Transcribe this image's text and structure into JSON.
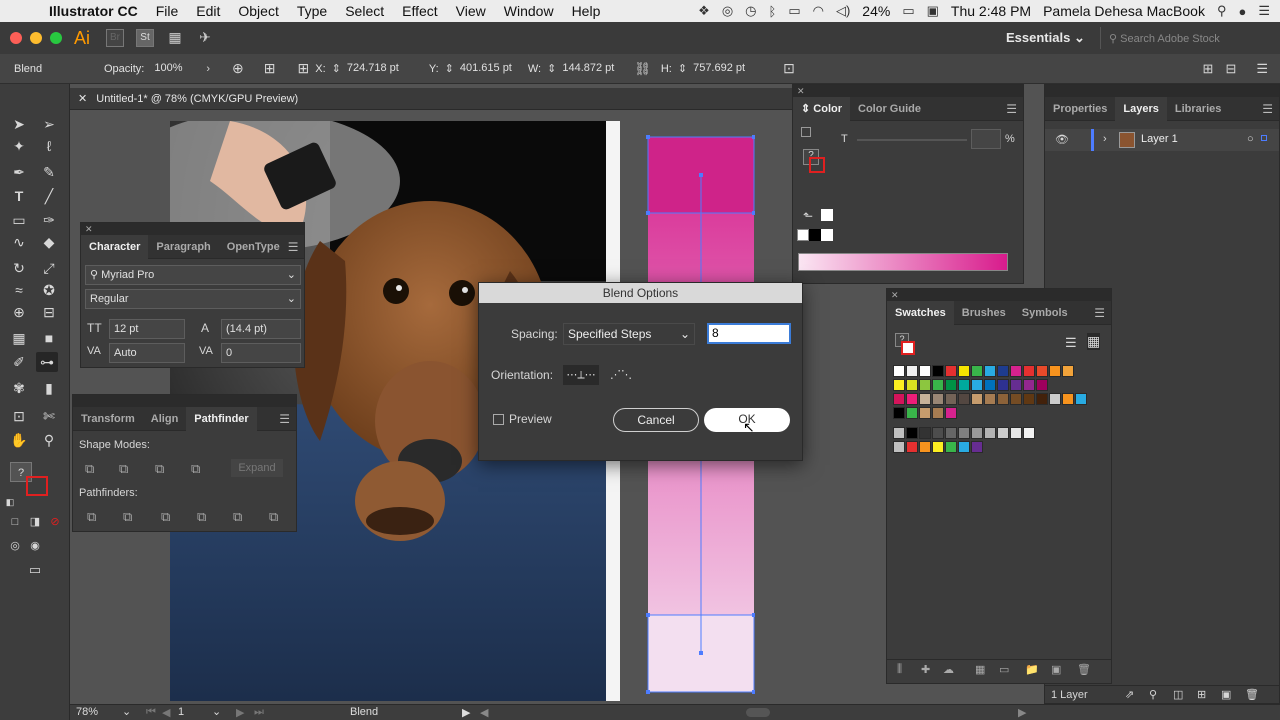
{
  "menubar": {
    "app_name": "Illustrator CC",
    "menus": [
      "File",
      "Edit",
      "Object",
      "Type",
      "Select",
      "Effect",
      "View",
      "Window",
      "Help"
    ],
    "battery": "24%",
    "clock": "Thu 2:48 PM",
    "user": "Pamela Dehesa MacBook"
  },
  "appbar": {
    "logo": "Ai",
    "br_label": "Br",
    "st_label": "St",
    "workspace": "Essentials",
    "search_placeholder": "Search Adobe Stock"
  },
  "controlbar": {
    "selection_label": "Blend",
    "opacity_label": "Opacity:",
    "opacity_value": "100%",
    "x_label": "X:",
    "x_value": "724.718 pt",
    "y_label": "Y:",
    "y_value": "401.615 pt",
    "w_label": "W:",
    "w_value": "144.872 pt",
    "h_label": "H:",
    "h_value": "757.692 pt"
  },
  "document": {
    "tab_title": "Untitled-1* @ 78% (CMYK/GPU Preview)"
  },
  "character_panel": {
    "tabs": [
      "Character",
      "Paragraph",
      "OpenType"
    ],
    "font_family": "Myriad Pro",
    "font_style": "Regular",
    "font_size": "12 pt",
    "leading": "(14.4 pt)",
    "kerning": "Auto",
    "tracking": "0"
  },
  "pathfinder_panel": {
    "tabs": [
      "Transform",
      "Align",
      "Pathfinder"
    ],
    "shape_modes_label": "Shape Modes:",
    "expand_label": "Expand",
    "pathfinders_label": "Pathfinders:"
  },
  "color_panel": {
    "tabs": [
      "Color",
      "Color Guide"
    ],
    "channel_label": "T",
    "percent_symbol": "%"
  },
  "right_panel": {
    "tabs": [
      "Properties",
      "Layers",
      "Libraries"
    ],
    "layer_name": "Layer 1",
    "footer": "1 Layer"
  },
  "swatches_panel": {
    "tabs": [
      "Swatches",
      "Brushes",
      "Symbols"
    ]
  },
  "blend_dialog": {
    "title": "Blend Options",
    "spacing_label": "Spacing:",
    "spacing_value": "Specified Steps",
    "steps_value": "8",
    "orientation_label": "Orientation:",
    "preview_label": "Preview",
    "cancel_label": "Cancel",
    "ok_label": "OK"
  },
  "statusbar": {
    "zoom": "78%",
    "artboard_number": "1",
    "status_text": "Blend"
  },
  "colors": {
    "accent_magenta": "#d6228e",
    "light_pink": "#f5dcee",
    "selection_blue": "#4d7cff"
  }
}
